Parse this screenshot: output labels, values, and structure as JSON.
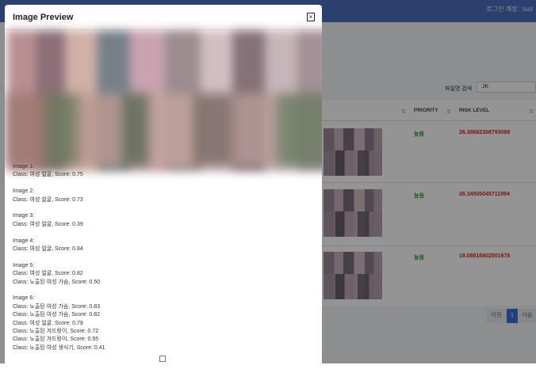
{
  "header": {
    "user_text": "로그인 계정 : tust"
  },
  "search": {
    "label": "파일명 검색",
    "value": "JK"
  },
  "table": {
    "columns": [
      {
        "label": ""
      },
      {
        "label": "PRIORITY"
      },
      {
        "label": "RISK LEVEL"
      }
    ],
    "sort_glyph": "⇅",
    "rows": [
      {
        "priority": "높음",
        "risk": "26.38682308793068"
      },
      {
        "priority": "높음",
        "risk": "26.34505045711994"
      },
      {
        "priority": "높음",
        "risk": "19.08816802501678"
      }
    ]
  },
  "pagination": {
    "prev": "이전",
    "page": "1",
    "next": "다음"
  },
  "modal": {
    "title": "Image Preview",
    "close": "×",
    "results": [
      {
        "title": "Image 1:",
        "lines": [
          "Class: 여성 얼굴, Score: 0.75"
        ]
      },
      {
        "title": "Image 2:",
        "lines": [
          "Class: 여성 얼굴, Score: 0.73"
        ]
      },
      {
        "title": "Image 3:",
        "lines": [
          "Class: 여성 얼굴, Score: 0.39"
        ]
      },
      {
        "title": "Image 4:",
        "lines": [
          "Class: 여성 얼굴, Score: 0.84"
        ]
      },
      {
        "title": "Image 5:",
        "lines": [
          "Class: 여성 얼굴, Score: 0.82",
          "Class: 노출된 여성 가슴, Score: 0.50"
        ]
      },
      {
        "title": "Image 6:",
        "lines": [
          "Class: 노출된 여성 가슴, Score: 0.83",
          "Class: 노출된 여성 가슴, Score: 0.82",
          "Class: 여성 얼굴, Score: 0.79",
          "Class: 노출된 겨드랑이, Score: 0.72",
          "Class: 노출된 겨드랑이, Score: 0.55",
          "Class: 노출된 여성 생식기, Score: 0.41"
        ]
      }
    ]
  }
}
